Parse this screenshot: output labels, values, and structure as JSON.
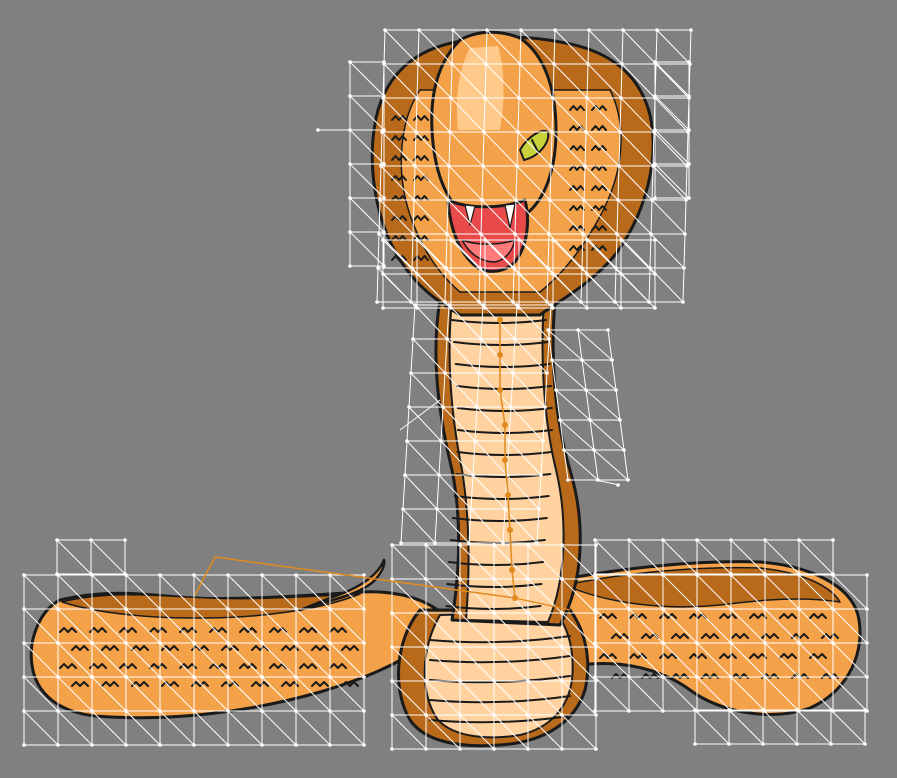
{
  "canvas": {
    "background": "#808080",
    "subject": "cobra-cartoon",
    "mesh_color": "#ffffff",
    "bone_color": "#e08a1e"
  },
  "palette": {
    "skin_light": "#ffc98a",
    "skin_mid": "#f4a24a",
    "skin_dark": "#b86a1a",
    "belly": "#ffd2a0",
    "outline": "#1a1a1a",
    "mouth": "#e84a4a",
    "mouth_inner": "#ff7a7a",
    "eye": "#c8d23a"
  }
}
